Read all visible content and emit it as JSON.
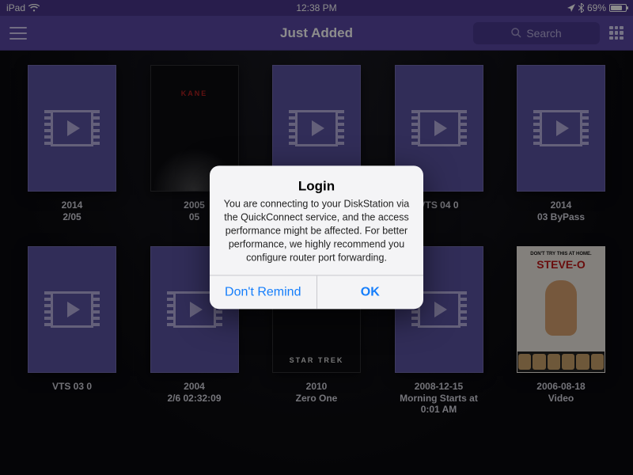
{
  "statusbar": {
    "device": "iPad",
    "time": "12:38 PM",
    "battery_pct": "69%"
  },
  "nav": {
    "title": "Just Added",
    "search_placeholder": "Search"
  },
  "items": [
    {
      "title": "2014",
      "subtitle": "2/05"
    },
    {
      "title": "2005",
      "subtitle": "05"
    },
    {
      "title": "",
      "subtitle": ""
    },
    {
      "title": "VTS 04 0",
      "subtitle": ""
    },
    {
      "title": "2014",
      "subtitle": "03 ByPass"
    },
    {
      "title": "VTS 03 0",
      "subtitle": ""
    },
    {
      "title": "2004",
      "subtitle": "2/6 02:32:09"
    },
    {
      "title": "2010",
      "subtitle": "Zero One"
    },
    {
      "title": "2008-12-15",
      "subtitle": "Morning Starts at 0:01 AM"
    },
    {
      "title": "2006-08-18",
      "subtitle": "Video"
    }
  ],
  "art": {
    "kane": "KANE",
    "trek": "STAR TREK",
    "steveo_top": "DON'T TRY THIS AT HOME.",
    "steveo": "STEVE-O"
  },
  "alert": {
    "title": "Login",
    "message": "You are connecting to your DiskStation via the QuickConnect service, and the access performance might be affected. For better performance, we highly recommend you configure router port forwarding.",
    "dont_remind": "Don't Remind",
    "ok": "OK"
  }
}
